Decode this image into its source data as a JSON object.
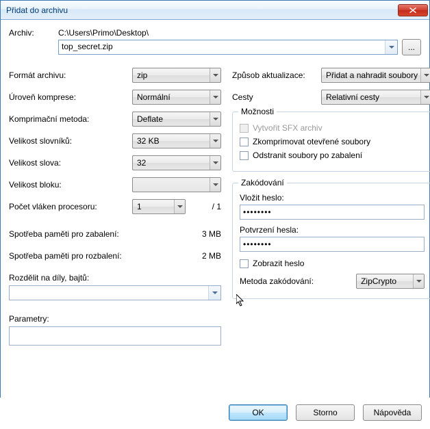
{
  "window": {
    "title": "Přidat do archivu"
  },
  "archive": {
    "label": "Archiv:",
    "path": "C:\\Users\\Primo\\Desktop\\",
    "filename": "top_secret.zip",
    "browse": "..."
  },
  "left": {
    "format_label": "Formát archivu:",
    "format_value": "zip",
    "compression_label": "Úroveň komprese:",
    "compression_value": "Normální",
    "method_label": "Komprimační metoda:",
    "method_value": "Deflate",
    "dict_label": "Velikost slovníků:",
    "dict_value": "32 KB",
    "word_label": "Velikost slova:",
    "word_value": "32",
    "block_label": "Velikost bloku:",
    "block_value": "",
    "threads_label": "Počet vláken procesoru:",
    "threads_value": "1",
    "threads_total": "/ 1",
    "mem_pack_label": "Spotřeba paměti pro zabalení:",
    "mem_pack_value": "3 MB",
    "mem_unpack_label": "Spotřeba paměti pro rozbalení:",
    "mem_unpack_value": "2 MB",
    "split_label": "Rozdělit na díly, bajtů:",
    "split_value": "",
    "params_label": "Parametry:",
    "params_value": ""
  },
  "right": {
    "update_label": "Způsob aktualizace:",
    "update_value": "Přidat a nahradit soubory",
    "paths_label": "Cesty",
    "paths_value": "Relativní cesty",
    "options_legend": "Možnosti",
    "opt_sfx": "Vytvořit SFX archiv",
    "opt_compress_open": "Zkomprimovat otevřené soubory",
    "opt_delete_after": "Odstranit soubory po zabalení",
    "enc_legend": "Zakódování",
    "pw_label": "Vložit heslo:",
    "pw_value": "••••••••",
    "pw2_label": "Potvrzení hesla:",
    "pw2_value": "••••••••",
    "show_pw": "Zobrazit heslo",
    "enc_method_label": "Metoda zakódování:",
    "enc_method_value": "ZipCrypto"
  },
  "buttons": {
    "ok": "OK",
    "cancel": "Storno",
    "help": "Nápověda"
  }
}
